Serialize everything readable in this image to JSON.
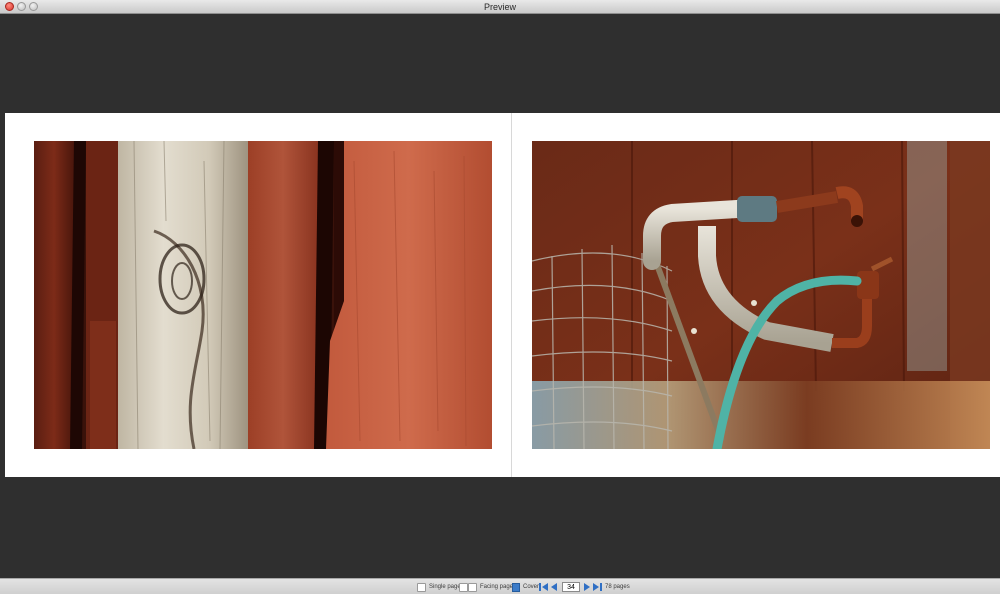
{
  "window": {
    "title": "Preview"
  },
  "spread": {
    "left_photo": {
      "subject": "weathered-wood-boards"
    },
    "right_photo": {
      "subject": "rusty-pipes-and-hose"
    }
  },
  "toolbar": {
    "single_page_label": "Single page",
    "facing_pages_label": "Facing pages",
    "cover_label": "Cover",
    "current_page": "34",
    "total_pages_label": "78 pages"
  },
  "colors": {
    "workspace": "#2f2f2f",
    "page": "#ffffff",
    "nav_blue": "#2f6fc4",
    "close_red": "#d8322a"
  },
  "icons": [
    "close-icon",
    "minimize-icon",
    "zoom-icon",
    "first-page-icon",
    "previous-page-icon",
    "next-page-icon",
    "last-page-icon",
    "cover-icon"
  ]
}
